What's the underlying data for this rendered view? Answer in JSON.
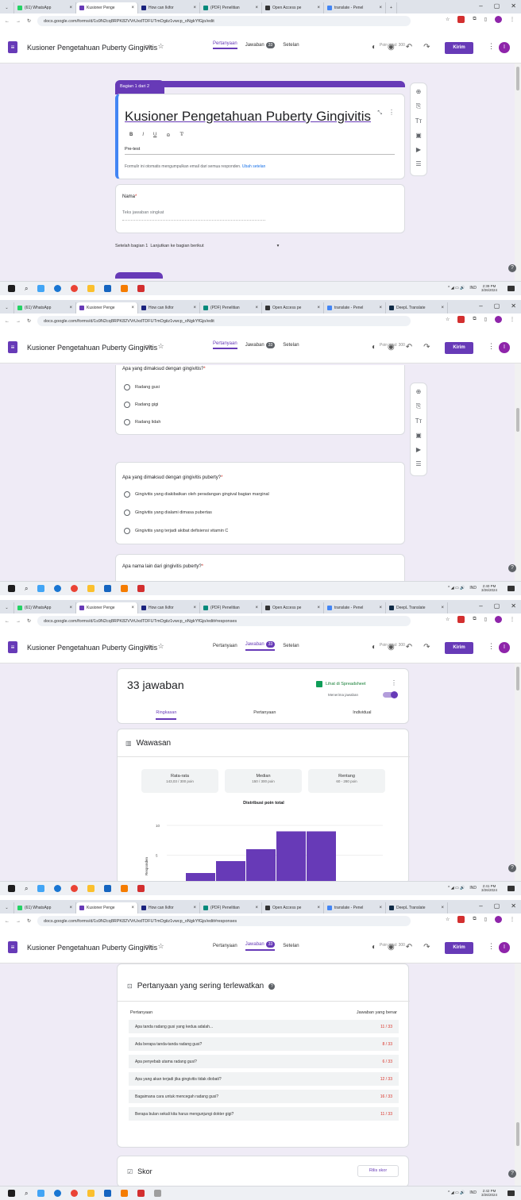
{
  "browser": {
    "tabs": [
      {
        "label": "(61) WhatsApp",
        "color": "#25d366"
      },
      {
        "label": "Kusioner Penge",
        "color": "#673ab7"
      },
      {
        "label": "How can Ikifor",
        "color": "#1a237e"
      },
      {
        "label": "(PDF) Penelitian",
        "color": "#00897b"
      },
      {
        "label": "Open Access pe",
        "color": "#333333"
      },
      {
        "label": "translate - Penel",
        "color": "#4285f4"
      },
      {
        "label": "DeepL Translate",
        "color": "#0f2b46"
      }
    ],
    "url_edit": "docs.google.com/forms/d/1s9N2cq8RPK82VVrUxdTDFUTmOgiiz1vwcp_oNgkYfGjo/edit",
    "url_responses": "docs.google.com/forms/d/1s9N2cq8RPK82VVrUxdTDFUTmOgiiz1vwcp_oNgkYfGjo/edit#responses",
    "url_edit_2": "docs.google.com/forms/d/1s9N2cq8RPK82VVrUxdTDFUTmOgiiz1vwcp_oNgkYfGjo/edit"
  },
  "app": {
    "title": "Kusioner Pengetahuan Puberty Gingivitis",
    "send_label": "Kirim",
    "avatar_letter": "I",
    "tab_questions": "Pertanyaan",
    "tab_responses": "Jawaban",
    "tab_settings": "Setelan",
    "responses_badge": "33",
    "total_points": "Poin total: 300"
  },
  "shot1": {
    "section_label": "Bagian 1 dari 2",
    "form_title": "Kusioner Pengetahuan Puberty Gingivitis",
    "description": "Pre-test",
    "email_notice": "Formulir ini otomatis mengumpulkan email dari semua responden.",
    "change_settings": "Ubah setelan",
    "name_label": "Nama",
    "name_placeholder": "Teks jawaban singkat",
    "after_section": "Setelah bagian 1",
    "after_section_value": "Lanjutkan ke bagian berikut",
    "time": "2:39 PM",
    "date": "3/26/2024"
  },
  "shot2": {
    "q1": "Apa yang dimaksud dengan gingivitis?",
    "q1_options": [
      "Radang gusi",
      "Radang gigi",
      "Radang lidah"
    ],
    "q2": "Apa yang dimaksud dengan gingivitis puberty?",
    "q2_options": [
      "Gingivitis yang diakibatkan oleh peradangan gingival bagian marginal",
      "Gingivitis yang dialami dimasa pubertas",
      "Gingivitis yang terjadi akibat defisiensi vitamin C"
    ],
    "q3": "Apa nama lain dari gingivitis puberty?",
    "time": "2:40 PM",
    "date": "3/26/2024"
  },
  "shot3": {
    "responses_count": "33 jawaban",
    "sheets_link": "Lihat di Spreadsheet",
    "accepting": "Menerima jawaban",
    "subtab_summary": "Ringkasan",
    "subtab_question": "Pertanyaan",
    "subtab_individual": "Individual",
    "insights": "Wawasan",
    "avg_label": "Rata-rata",
    "avg_value": "143,03 / 300 poin",
    "median_label": "Median",
    "median_value": "150 / 300 poin",
    "range_label": "Rentang",
    "range_value": "60 - 280 poin",
    "dist_title": "Distribusi poin total",
    "y_label": "Responden",
    "time": "2:41 PM",
    "date": "3/26/2024"
  },
  "chart_data": {
    "type": "bar",
    "title": "Distribusi poin total",
    "ylabel": "Responden",
    "ylim": [
      0,
      12
    ],
    "y_ticks": [
      5,
      10
    ],
    "values": [
      2,
      4,
      6,
      9,
      9
    ],
    "color": "#673ab7"
  },
  "shot4": {
    "missed_title": "Pertanyaan yang sering terlewatkan",
    "col_question": "Pertanyaan",
    "col_correct": "Jawaban yang benar",
    "rows": [
      {
        "q": "Apa tanda radang gusi yang kedua adalah...",
        "n": "11 / 33"
      },
      {
        "q": "Ada berapa tanda-tanda radang gusi?",
        "n": "8 / 33"
      },
      {
        "q": "Apa penyebab utama radang gusi?",
        "n": "6 / 33"
      },
      {
        "q": "Apa yang akan terjadi jika gingivitis tidak diobati?",
        "n": "12 / 33"
      },
      {
        "q": "Bagaimana cara untuk mencegah radang gusi?",
        "n": "16 / 33"
      },
      {
        "q": "Berapa bulan sekali kita harus mengunjungi dokter gigi?",
        "n": "11 / 33"
      }
    ],
    "score_title": "Skor",
    "release_scores": "Rilis skor",
    "time": "2:42 PM",
    "date": "3/26/2024"
  },
  "tray": {
    "lang": "IND"
  }
}
